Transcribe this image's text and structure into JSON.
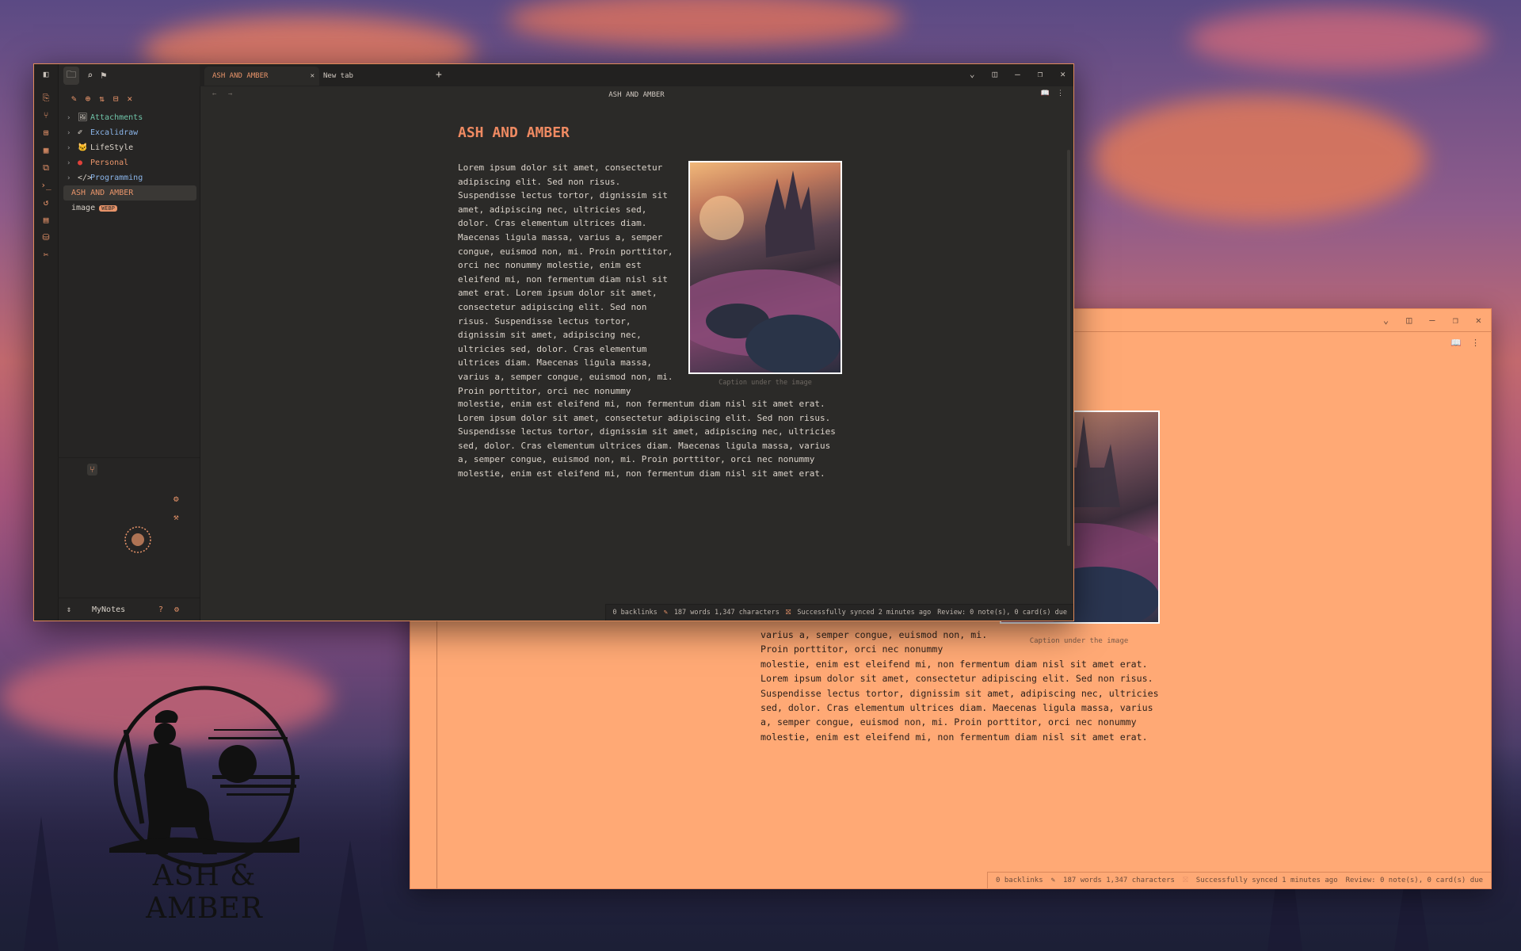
{
  "front_window": {
    "tabs": [
      {
        "label": "ASH AND AMBER",
        "active": true
      },
      {
        "label": "New tab",
        "active": false
      }
    ],
    "new_tab_symbol": "+",
    "nav_title": "ASH AND AMBER",
    "file_tree": [
      {
        "label": "Attachments",
        "icon": "image-icon",
        "color": "#6fc3a8"
      },
      {
        "label": "Excalidraw",
        "icon": "excalidraw-icon",
        "color": "#8ab4e8"
      },
      {
        "label": "LifeStyle",
        "icon": "cat-emoji-icon",
        "color": "#d9d2c9"
      },
      {
        "label": "Personal",
        "icon": "red-circle-icon",
        "color": "#e8946a"
      },
      {
        "label": "Programming",
        "icon": "code-icon",
        "color": "#8ab4e8"
      }
    ],
    "selected_file": "ASH AND AMBER",
    "image_file": {
      "label": "image",
      "tag": "WEBP"
    },
    "vault_name": "MyNotes",
    "note": {
      "title": "ASH AND AMBER",
      "para_wrapped": "Lorem ipsum dolor sit amet, consectetur\nadipiscing elit. Sed non risus.\nSuspendisse lectus tortor, dignissim sit\namet, adipiscing nec, ultricies sed,\ndolor. Cras elementum ultrices diam.\nMaecenas ligula massa, varius a, semper\ncongue, euismod non, mi. Proin porttitor,\norci nec nonummy molestie, enim est\neleifend mi, non fermentum diam nisl sit\namet erat. Lorem ipsum dolor sit amet,\nconsectetur adipiscing elit. Sed non\nrisus. Suspendisse lectus tortor,\ndignissim sit amet, adipiscing nec,\nultricies sed, dolor. Cras elementum\nultrices diam. Maecenas ligula massa,\nvarius a, semper congue, euismod non, mi.\nProin porttitor, orci nec nonummy",
      "para_full": "molestie, enim est eleifend mi, non fermentum diam nisl sit amet erat.\nLorem ipsum dolor sit amet, consectetur adipiscing elit. Sed non risus.\nSuspendisse lectus tortor, dignissim sit amet, adipiscing nec, ultricies\nsed, dolor. Cras elementum ultrices diam. Maecenas ligula massa, varius\na, semper congue, euismod non, mi. Proin porttitor, orci nec nonummy\nmolestie, enim est eleifend mi, non fermentum diam nisl sit amet erat.",
      "caption": "Caption under the image"
    },
    "status": {
      "backlinks": "0 backlinks",
      "counts": "187 words 1,347 characters",
      "sync": "Successfully synced 2 minutes ago",
      "review": "Review: 0 note(s), 0 card(s) due"
    }
  },
  "back_window": {
    "para": "varius a, semper congue, euismod non, mi.\nProin porttitor, orci nec nonummy\nmolestie, enim est eleifend mi, non fermentum diam nisl sit amet erat.\nLorem ipsum dolor sit amet, consectetur adipiscing elit. Sed non risus.\nSuspendisse lectus tortor, dignissim sit amet, adipiscing nec, ultricies\nsed, dolor. Cras elementum ultrices diam. Maecenas ligula massa, varius\na, semper congue, euismod non, mi. Proin porttitor, orci nec nonummy\nmolestie, enim est eleifend mi, non fermentum diam nisl sit amet erat.",
    "caption": "Caption under the image",
    "status": {
      "backlinks": "0 backlinks",
      "counts": "187 words 1,347 characters",
      "sync": "Successfully synced 1 minutes ago",
      "review": "Review: 0 note(s), 0 card(s) due"
    }
  },
  "logo": {
    "text": "ASH & AMBER"
  },
  "colors": {
    "accent": "#e8946a",
    "title": "#ef8a62",
    "dark_bg": "#2b2a28",
    "peach_bg": "#ffa975"
  }
}
